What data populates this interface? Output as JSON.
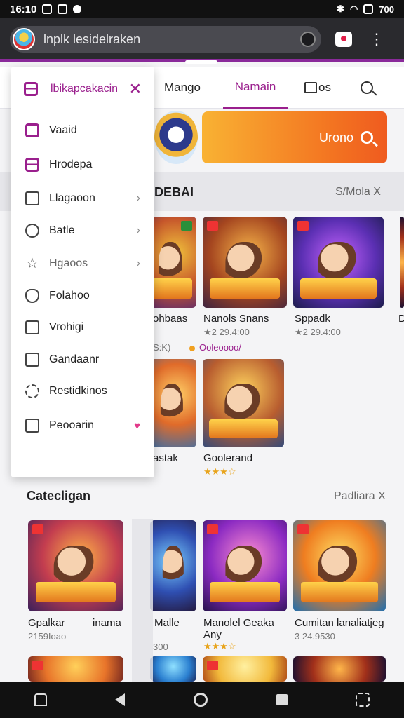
{
  "status_bar": {
    "time": "16:10",
    "battery": "700"
  },
  "browser": {
    "url": "lnplk lesidelraken"
  },
  "tabs": [
    {
      "label": "Mango"
    },
    {
      "label": "Namain"
    },
    {
      "label": "Dos"
    }
  ],
  "hero": {
    "search_label": "Urono"
  },
  "section1": {
    "title": "DEBAI",
    "link": "S/Mola X"
  },
  "section2": {
    "title": "Catecligan",
    "link": "Padliara X"
  },
  "cards_row1": [
    {
      "title": "ohbaas",
      "meta": "S:K)"
    },
    {
      "title": "Nanols Snans",
      "meta": "★2 29.4:00",
      "extra": "Ooleoooo/"
    },
    {
      "title": "Sppadk",
      "meta": "★2 29.4:00"
    },
    {
      "title": "D",
      "meta": ""
    }
  ],
  "cards_row2": [
    {
      "title": "astak",
      "meta": ""
    },
    {
      "title": "Goolerand",
      "meta": "★★★☆"
    }
  ],
  "cards_row3": [
    {
      "title": "Gpalkar",
      "title2": "inama",
      "meta": "2159Ioao"
    },
    {
      "title": "Malle",
      "meta": "300"
    },
    {
      "title": "Manolel Geaka",
      "title2": "Any",
      "meta": "★★★☆"
    },
    {
      "title": "Cumitan lanaliatjeg",
      "meta": "3 24.9530"
    }
  ],
  "drawer": {
    "header": "lbikapcakacin",
    "items": [
      {
        "label": "Vaaid",
        "icon": "square-icon",
        "chevron": false
      },
      {
        "label": "Hrodepa",
        "icon": "tag-icon",
        "chevron": false
      },
      {
        "label": "Llagaoon",
        "icon": "window-icon",
        "chevron": true
      },
      {
        "label": "Batle",
        "icon": "user-icon",
        "chevron": true
      },
      {
        "label": "Hgaoos",
        "icon": "star-icon",
        "chevron": true
      },
      {
        "label": "Folahoo",
        "icon": "shield-icon",
        "chevron": false
      },
      {
        "label": "Vrohigi",
        "icon": "check-icon",
        "chevron": false
      },
      {
        "label": "Gandaanr",
        "icon": "page-icon",
        "chevron": false
      },
      {
        "label": "Restidkinos",
        "icon": "gear-icon",
        "chevron": false
      },
      {
        "label": "Peooarin",
        "icon": "map-icon",
        "chevron": false,
        "heart": true
      }
    ]
  },
  "colors": {
    "accent": "#9a1f8d",
    "hero_gradient_start": "#f9b233",
    "hero_gradient_end": "#ef5b1f"
  }
}
